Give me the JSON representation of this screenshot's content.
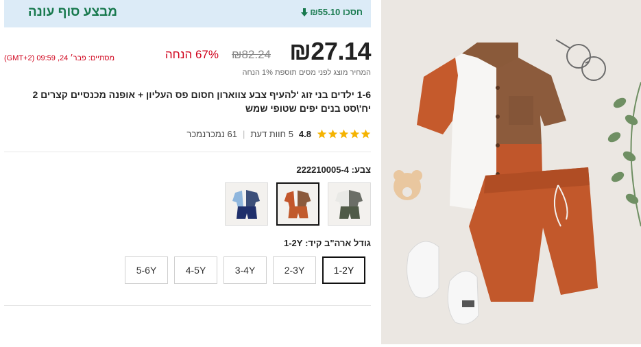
{
  "banner": {
    "title": "מבצע סוף עונה",
    "save_label": "חסכו ₪55.10"
  },
  "price": {
    "current": "₪27.14",
    "original": "₪82.24",
    "discount": "67% הנחה",
    "ends": "מסתיים: פבר׳ 24, 09:59 (GMT+2)",
    "tax_note": "המחיר מוצג לפני מסים תוספת 1% הנחה"
  },
  "product": {
    "title": "1-6 ילדים בני זוג 'להעיף צבע צווארון חסום פס העליון + אופנה מכנסיים קצרים 2 יח'\\סט בנים יפים שטופי שמש"
  },
  "rating": {
    "score": "4.8",
    "stars": 5,
    "reviews": "5 חוות דעת",
    "sold": "61 נמכרנמכר"
  },
  "color": {
    "label": "צבע: 222210005-4",
    "options": [
      {
        "name": "green-grey",
        "selected": false
      },
      {
        "name": "rust-brown",
        "selected": true
      },
      {
        "name": "blue-navy",
        "selected": false
      }
    ]
  },
  "size": {
    "label": "גודל ארה\"ב קיד: 1-2Y",
    "options": [
      "1-2Y",
      "2-3Y",
      "3-4Y",
      "4-5Y",
      "5-6Y"
    ],
    "selected_index": 0
  },
  "colors": {
    "brand_green": "#18794e",
    "sale_red": "#d0021b",
    "banner_bg": "#dcebf7",
    "star": "#f5b301"
  }
}
